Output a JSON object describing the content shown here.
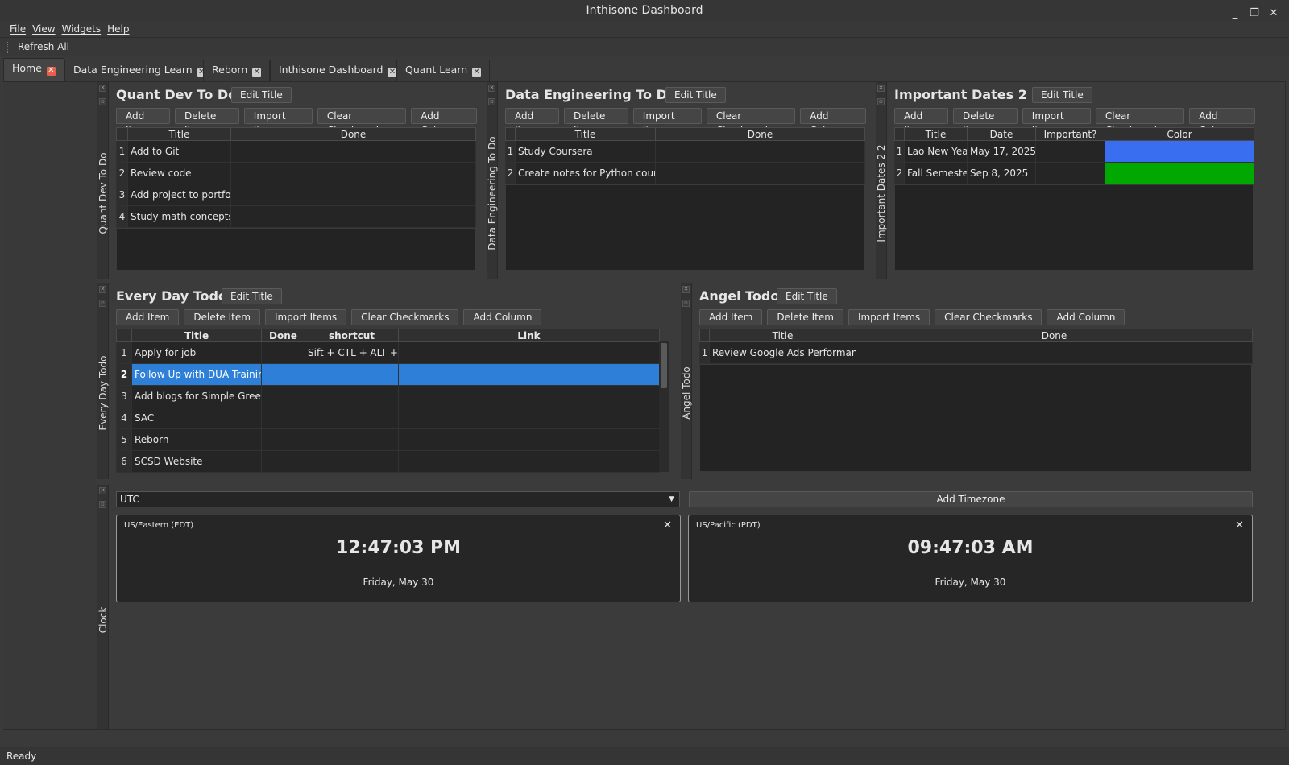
{
  "window": {
    "title": "Inthisone Dashboard"
  },
  "menu": [
    "File",
    "View",
    "Widgets",
    "Help"
  ],
  "toolbar": {
    "refresh_label": "Refresh All"
  },
  "tabs": [
    {
      "label": "Home",
      "active": true
    },
    {
      "label": "Data Engineering Learn"
    },
    {
      "label": "Reborn"
    },
    {
      "label": "Inthisone Dashboard"
    },
    {
      "label": "Quant Learn"
    }
  ],
  "buttons": {
    "edit_title": "Edit Title",
    "add_item": "Add Item",
    "delete_item": "Delete Item",
    "import_items": "Import Items",
    "clear_checkmarks": "Clear Checkmarks",
    "add_column": "Add Column"
  },
  "widgets": {
    "quant": {
      "title": "Quant Dev To Do",
      "dock_label": "Quant Dev To Do",
      "columns": [
        "Title",
        "Done"
      ],
      "rows": [
        {
          "n": "1",
          "title": "Add to Git"
        },
        {
          "n": "2",
          "title": "Review code"
        },
        {
          "n": "3",
          "title": "Add project to portfolio"
        },
        {
          "n": "4",
          "title": "Study math concepts"
        }
      ]
    },
    "dataeng": {
      "title": "Data Engineering To Do",
      "dock_label": "Data Engineering To Do",
      "columns": [
        "Title",
        "Done"
      ],
      "rows": [
        {
          "n": "1",
          "title": "Study Coursera"
        },
        {
          "n": "2",
          "title": "Create notes for Python course"
        }
      ]
    },
    "dates": {
      "title": "Important Dates 2 2",
      "dock_label": "Important Dates 2 2",
      "columns": [
        "Title",
        "Date",
        "Important?",
        "Color"
      ],
      "rows": [
        {
          "n": "1",
          "title": "Lao New Year",
          "date": "May 17, 2025",
          "color": "#3a6ef0"
        },
        {
          "n": "2",
          "title": "Fall Semester",
          "date": "Sep 8, 2025",
          "color": "#00a800"
        }
      ]
    },
    "everyday": {
      "title": "Every Day Todo",
      "dock_label": "Every Day Todo",
      "columns": [
        "Title",
        "Done",
        "shortcut",
        "Link"
      ],
      "rows": [
        {
          "n": "1",
          "title": "Apply for job",
          "shortcut": "Sift + CTL + ALT + J"
        },
        {
          "n": "2",
          "title": "Follow Up with DUA Training",
          "shortcut": "",
          "selected": true
        },
        {
          "n": "3",
          "title": "Add blogs for Simple Greens",
          "shortcut": ""
        },
        {
          "n": "4",
          "title": "SAC",
          "shortcut": ""
        },
        {
          "n": "5",
          "title": "Reborn",
          "shortcut": ""
        },
        {
          "n": "6",
          "title": "SCSD Website",
          "shortcut": ""
        }
      ]
    },
    "angel": {
      "title": "Angel Todo",
      "dock_label": "Angel Todo",
      "columns": [
        "Title",
        "Done"
      ],
      "rows": [
        {
          "n": "1",
          "title": "Review Google Ads Performance"
        }
      ]
    },
    "clock": {
      "dock_label": "Clock",
      "timezone_select": "UTC",
      "add_timezone_label": "Add Timezone",
      "cards": [
        {
          "zone": "US/Eastern (EDT)",
          "time": "12:47:03 PM",
          "date": "Friday, May 30"
        },
        {
          "zone": "US/Pacific (PDT)",
          "time": "09:47:03 AM",
          "date": "Friday, May 30"
        }
      ]
    }
  },
  "status": "Ready",
  "icons": {
    "close": "close-icon",
    "minimize": "minimize-icon",
    "restore": "restore-icon",
    "dropdown": "chevron-down-icon"
  },
  "colors": {
    "selection": "#2d7fd8",
    "active_tab_close": "#e6604a"
  }
}
